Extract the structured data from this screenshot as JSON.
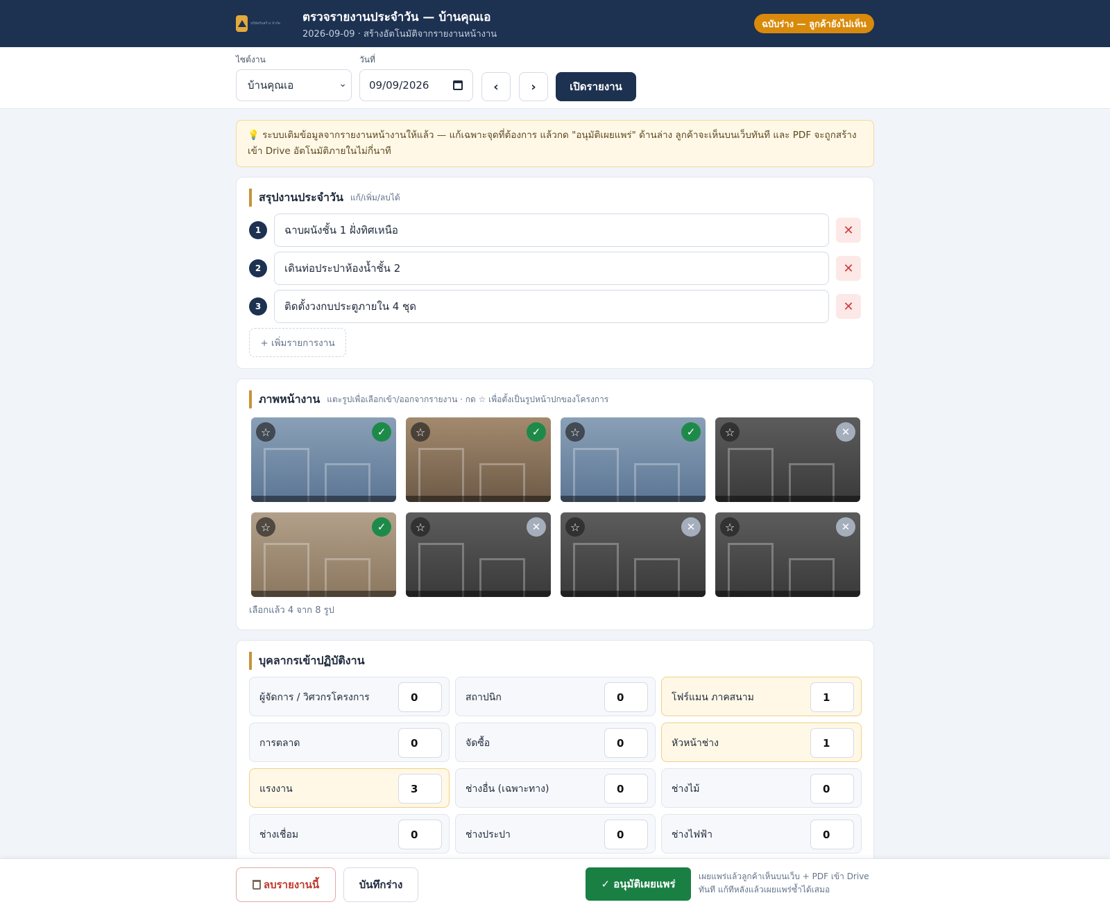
{
  "header": {
    "logo_text": "บริษัทรับสร้าง จำกัด",
    "title": "ตรวจรายงานประจำวัน — บ้านคุณเอ",
    "subtitle": "2026-09-09 · สร้างอัตโนมัติจากรายงานหน้างาน",
    "status_badge": "ฉบับร่าง — ลูกค้ายังไม่เห็น"
  },
  "toolbar": {
    "site_label": "ไซต์งาน",
    "site_value": "บ้านคุณเอ",
    "date_label": "วันที่",
    "date_value": "09/09/2026",
    "prev_label": "‹",
    "next_label": "›",
    "open_label": "เปิดรายงาน"
  },
  "banner": {
    "icon": "lightbulb-icon",
    "text": "💡 ระบบเติมข้อมูลจากรายงานหน้างานให้แล้ว — แก้เฉพาะจุดที่ต้องการ แล้วกด \"อนุมัติเผยแพร่\" ด้านล่าง ลูกค้าจะเห็นบนเว็บทันที และ PDF จะถูกสร้างเข้า Drive อัตโนมัติภายในไม่กี่นาที"
  },
  "summary": {
    "title": "สรุปงานประจำวัน",
    "hint": "แก้/เพิ่ม/ลบได้",
    "tasks": [
      {
        "num": "1",
        "text": "ฉาบผนังชั้น 1 ฝั่งทิศเหนือ"
      },
      {
        "num": "2",
        "text": "เดินท่อประปาห้องน้ำชั้น 2"
      },
      {
        "num": "3",
        "text": "ติดตั้งวงกบประตูภายใน 4 ชุด"
      }
    ],
    "delete_glyph": "✕",
    "add_label": "+ เพิ่มรายการงาน"
  },
  "photos": {
    "title": "ภาพหน้างาน",
    "hint": "แตะรูปเพื่อเลือกเข้า/ออกจากรายงาน · กด ☆ เพื่อตั้งเป็นรูปหน้าปกของโครงการ",
    "star_glyph": "☆",
    "check_glyph": "✓",
    "cross_glyph": "✕",
    "items": [
      {
        "tone": "blue",
        "selected": true
      },
      {
        "tone": "brown",
        "selected": true
      },
      {
        "tone": "blue",
        "selected": true
      },
      {
        "tone": "grey",
        "selected": false
      },
      {
        "tone": "tan",
        "selected": true
      },
      {
        "tone": "grey",
        "selected": false
      },
      {
        "tone": "grey",
        "selected": false
      },
      {
        "tone": "grey",
        "selected": false
      }
    ],
    "count_text": "เลือกแล้ว 4 จาก 8 รูป"
  },
  "staff": {
    "title": "บุคลากรเข้าปฏิบัติงาน",
    "roles": [
      {
        "label": "ผู้จัดการ / วิศวกรโครงการ",
        "value": "0",
        "highlight": false
      },
      {
        "label": "สถาปนิก",
        "value": "0",
        "highlight": false
      },
      {
        "label": "โฟร์แมน ภาคสนาม",
        "value": "1",
        "highlight": true
      },
      {
        "label": "การตลาด",
        "value": "0",
        "highlight": false
      },
      {
        "label": "จัดซื้อ",
        "value": "0",
        "highlight": false
      },
      {
        "label": "หัวหน้าช่าง",
        "value": "1",
        "highlight": true
      },
      {
        "label": "แรงงาน",
        "value": "3",
        "highlight": true
      },
      {
        "label": "ช่างอื่น (เฉพาะทาง)",
        "value": "0",
        "highlight": false
      },
      {
        "label": "ช่างไม้",
        "value": "0",
        "highlight": false
      },
      {
        "label": "ช่างเชื่อม",
        "value": "0",
        "highlight": false
      },
      {
        "label": "ช่างประปา",
        "value": "0",
        "highlight": false
      },
      {
        "label": "ช่างไฟฟ้า",
        "value": "0",
        "highlight": false
      }
    ]
  },
  "footer": {
    "delete_label": "ลบรายงานนี้",
    "save_label": "บันทึกร่าง",
    "publish_label": "✓ อนุมัติเผยแพร่",
    "publish_note": "เผยแพร่แล้วลูกค้าเห็นบนเว็บ + PDF เข้า Drive ทันที แก้ทีหลังแล้วเผยแพร่ซ้ำได้เสมอ"
  },
  "colors": {
    "navy": "#1d3151",
    "accent": "#d98a0b",
    "publish_green": "#1a7f43",
    "danger": "#c0392b"
  }
}
